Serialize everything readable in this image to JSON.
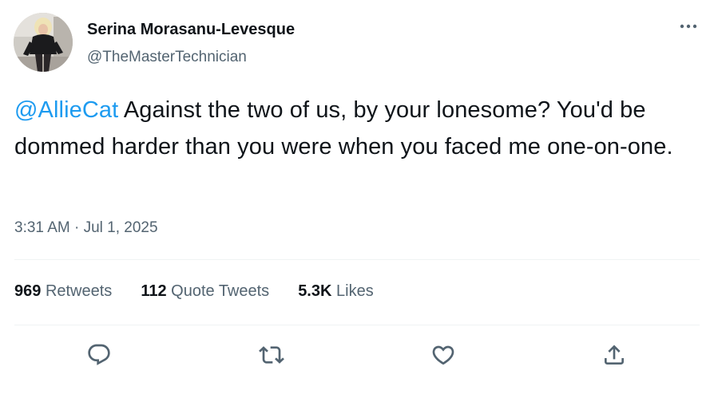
{
  "author": {
    "name": "Serina Morasanu-Levesque",
    "handle": "@TheMasterTechnician",
    "avatar_icon": "profile-photo"
  },
  "tweet": {
    "mention": "@AllieCat",
    "text": " Against the two of us, by your lonesome? You'd be dommed harder than you were when you faced me one-on-one.",
    "timestamp": "3:31 AM · Jul 1, 2025"
  },
  "stats": {
    "retweets_count": "969",
    "retweets_label": "Retweets",
    "quotes_count": "112",
    "quotes_label": "Quote Tweets",
    "likes_count": "5.3K",
    "likes_label": "Likes"
  },
  "actions": [
    "reply-icon",
    "retweet-icon",
    "like-icon",
    "share-icon"
  ],
  "colors": {
    "accent": "#1d9bf0",
    "text": "#0f1419",
    "secondary": "#536471",
    "divider": "#eff3f4"
  }
}
